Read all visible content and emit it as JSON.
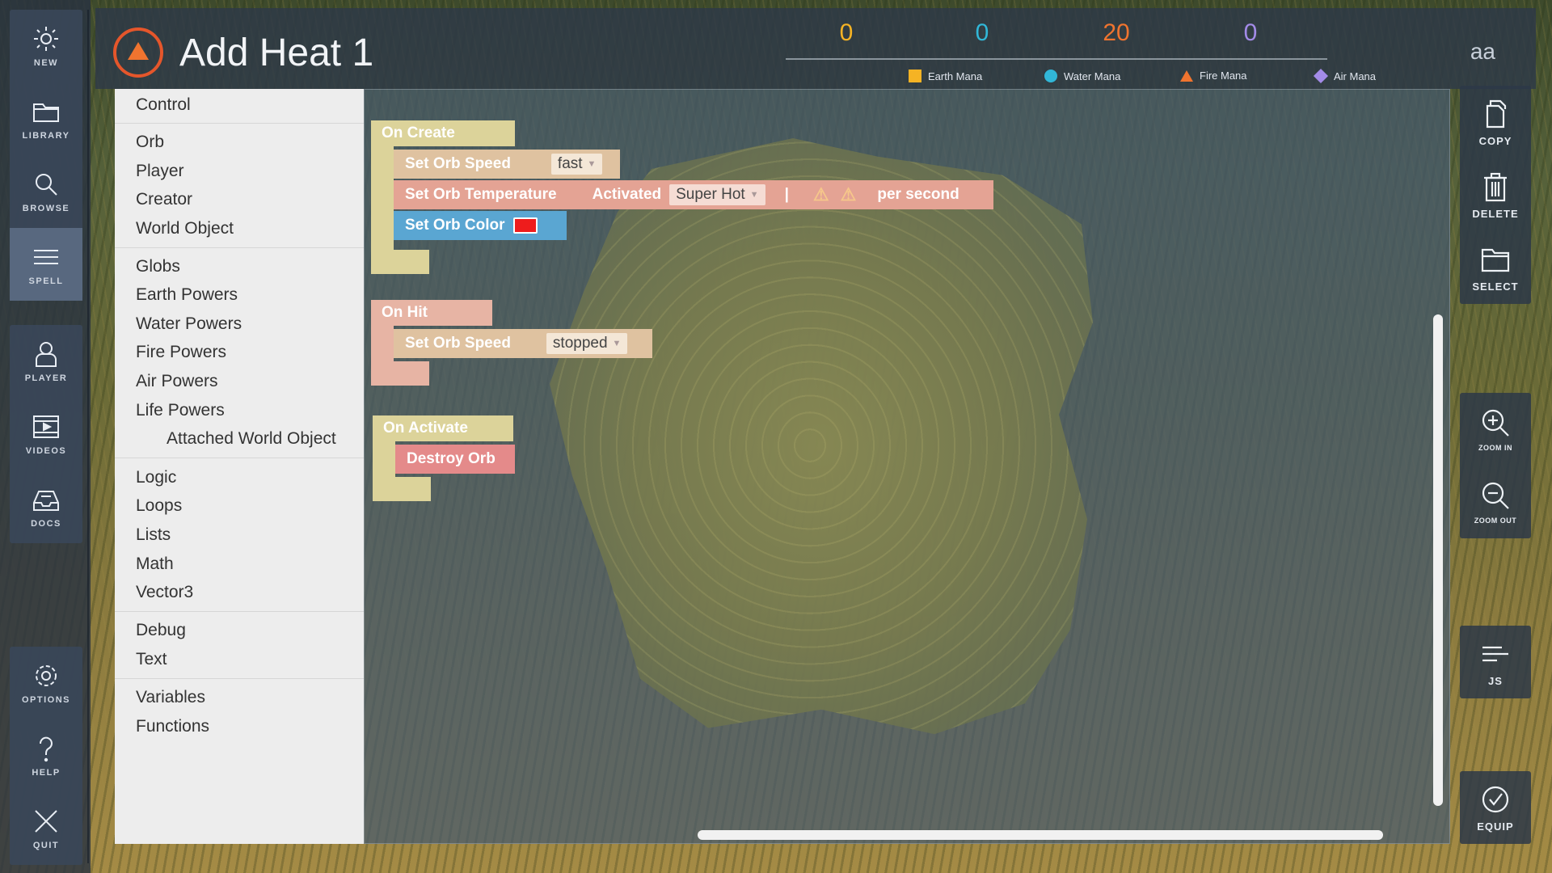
{
  "title": "Add Heat 1",
  "aa": "aa",
  "mana": [
    {
      "value": "0",
      "label": "Earth Mana",
      "color": "#f5b324"
    },
    {
      "value": "0",
      "label": "Water Mana",
      "color": "#31b7d8"
    },
    {
      "value": "20",
      "label": "Fire Mana",
      "color": "#f0742f"
    },
    {
      "value": "0",
      "label": "Air Mana",
      "color": "#a38be8"
    }
  ],
  "left_nav": {
    "new": "NEW",
    "library": "LIBRARY",
    "browse": "BROWSE",
    "spell": "SPELL",
    "player": "PLAYER",
    "videos": "VIDEOS",
    "docs": "DOCS",
    "options": "OPTIONS",
    "help": "HELP",
    "quit": "QUIT"
  },
  "categories": {
    "control": "Control",
    "orb": "Orb",
    "player": "Player",
    "creator": "Creator",
    "world_object": "World Object",
    "globs": "Globs",
    "earth_powers": "Earth Powers",
    "water_powers": "Water Powers",
    "fire_powers": "Fire Powers",
    "air_powers": "Air Powers",
    "life_powers": "Life Powers",
    "attached_world_object": "Attached World Object",
    "logic": "Logic",
    "loops": "Loops",
    "lists": "Lists",
    "math": "Math",
    "vector3": "Vector3",
    "debug": "Debug",
    "text": "Text",
    "variables": "Variables",
    "functions": "Functions"
  },
  "blocks": {
    "on_create": "On Create",
    "set_orb_speed": "Set Orb Speed",
    "speed_fast": "fast",
    "set_orb_temperature": "Set Orb Temperature",
    "activated": "Activated",
    "temp_value": "Super Hot",
    "pipe": "|",
    "warn1": "⚠",
    "warn2": "⚠",
    "per_second": "per second",
    "set_orb_color": "Set Orb Color",
    "orb_color": "#ee1c1c",
    "on_hit": "On Hit",
    "set_orb_speed_2": "Set Orb Speed",
    "speed_stopped": "stopped",
    "on_activate": "On Activate",
    "destroy_orb": "Destroy Orb"
  },
  "right_bar": {
    "copy": "COPY",
    "delete": "DELETE",
    "select": "SELECT",
    "zoom_in": "ZOOM IN",
    "zoom_out": "ZOOM OUT",
    "js": "JS",
    "equip": "EQUIP"
  }
}
